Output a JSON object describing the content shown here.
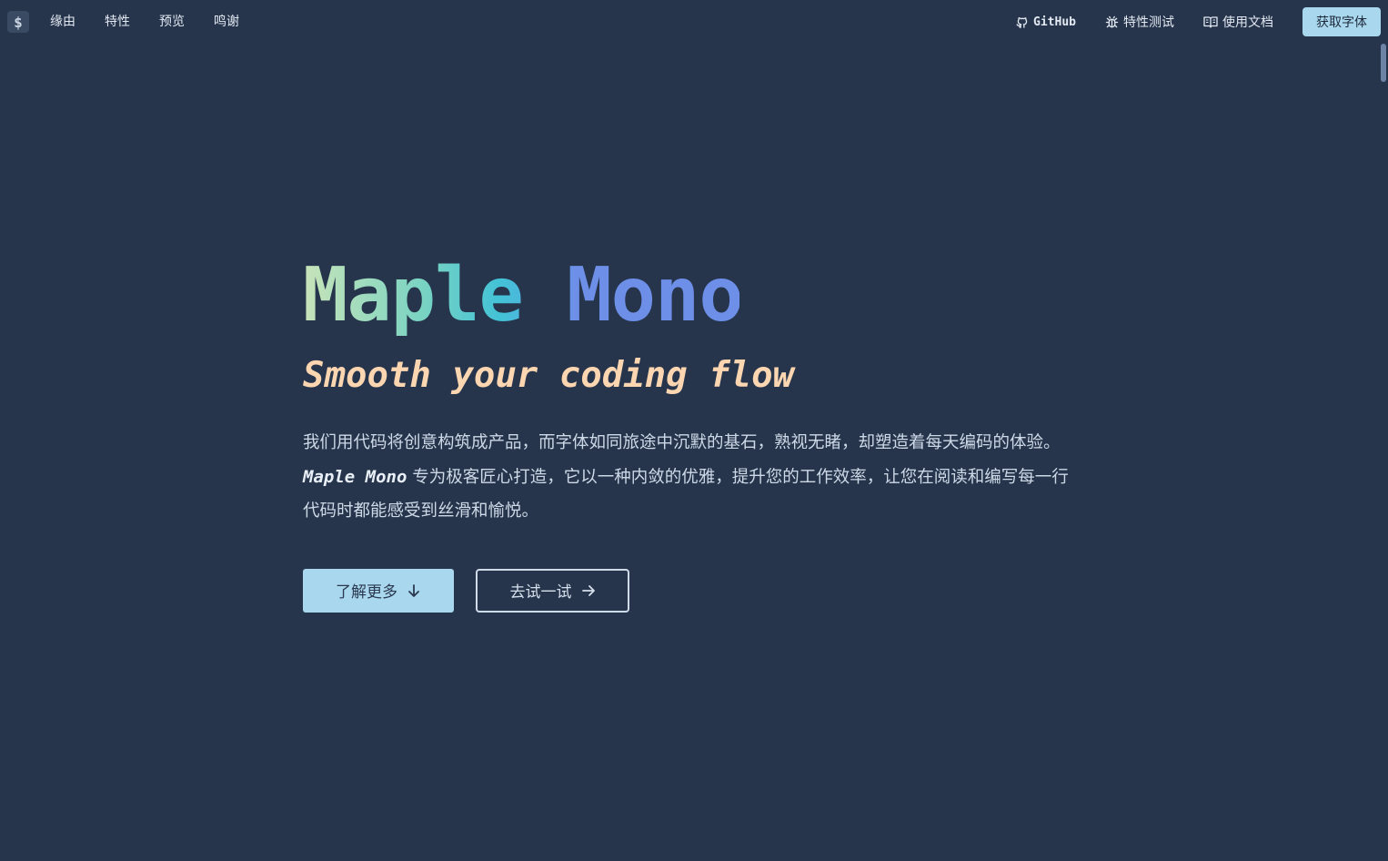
{
  "nav": {
    "logo_symbol": "$",
    "links": [
      "缘由",
      "特性",
      "预览",
      "鸣谢"
    ],
    "github_label": "GitHub",
    "playground_label": "特性测试",
    "docs_label": "使用文档",
    "cta_label": "获取字体"
  },
  "hero": {
    "title": "Maple Mono",
    "subtitle": "Smooth your coding flow",
    "desc_before": "我们用代码将创意构筑成产品，而字体如同旅途中沉默的基石，熟视无睹，却塑造着每天编码的体验。",
    "desc_brand": "Maple Mono",
    "desc_after": " 专为极客匠心打造，它以一种内敛的优雅，提升您的工作效率，让您在阅读和编写每一行代码时都能感受到丝滑和愉悦。",
    "primary_button": "了解更多",
    "secondary_button": "去试一试"
  },
  "colors": {
    "background": "#26354c",
    "accent": "#a9d7ed",
    "subtitle": "#fcd5b1"
  }
}
